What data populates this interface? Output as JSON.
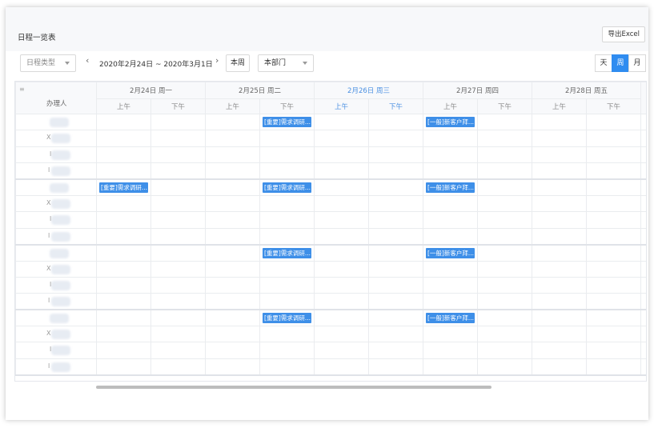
{
  "header": {
    "title": "日程一览表",
    "export_label": "导出Excel"
  },
  "toolbar": {
    "type_filter": "日程类型",
    "prev_icon": "chevron-left-icon",
    "next_icon": "chevron-right-icon",
    "date_range": "2020年2月24日 ~ 2020年3月1日",
    "this_week": "本周",
    "dept_filter": "本部门",
    "views": [
      "天",
      "周",
      "月"
    ],
    "active_view": "周"
  },
  "table": {
    "assignee_header": "办理人",
    "days": [
      {
        "label": "2月24日 周一",
        "today": false
      },
      {
        "label": "2月25日 周二",
        "today": false
      },
      {
        "label": "2月26日 周三",
        "today": true
      },
      {
        "label": "2月27日 周四",
        "today": false
      },
      {
        "label": "2月28日 周五",
        "today": false
      }
    ],
    "am": "上午",
    "pm": "下午",
    "row_initials": [
      "",
      "X",
      "l",
      "l"
    ],
    "events": {
      "important": "[重要]需求调研...",
      "normal": "[一般]新客户拜..."
    }
  },
  "colors": {
    "accent": "#2f8cf0",
    "event": "#3e8fe8",
    "today": "#4a90e2"
  }
}
